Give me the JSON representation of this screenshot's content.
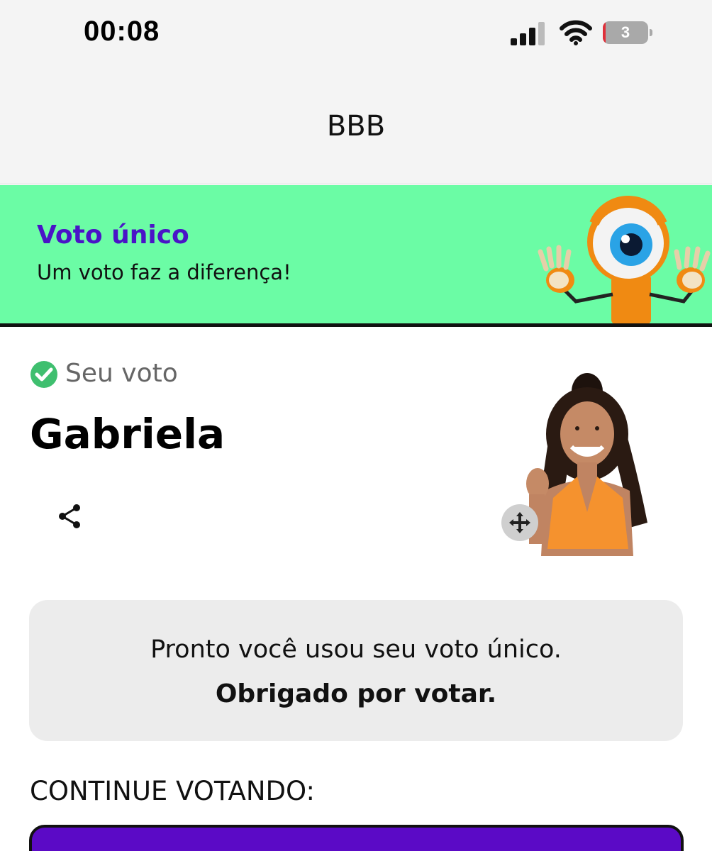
{
  "status_bar": {
    "time": "00:08",
    "battery_level": "3",
    "battery_color": "#e0303a",
    "icons": [
      "signal-icon",
      "wifi-icon",
      "battery-icon"
    ]
  },
  "nav": {
    "title": "BBB"
  },
  "banner": {
    "title": "Voto único",
    "subtitle": "Um voto faz a diferença!",
    "background": "#6bfca5",
    "title_color": "#4a14c7",
    "icon": "big-brother-eye-mascot"
  },
  "vote": {
    "status_label": "Seu voto",
    "status_icon": "check-circle-icon",
    "status_color": "#3fbf6f",
    "candidate_name": "Gabriela",
    "share_icon": "share-icon",
    "move_icon": "move-arrows-icon"
  },
  "confirmation": {
    "line1": "Pronto você usou seu voto único.",
    "line2": "Obrigado por votar."
  },
  "continue": {
    "label": "CONTINUE VOTANDO:",
    "button_color": "#5b0ac6"
  }
}
